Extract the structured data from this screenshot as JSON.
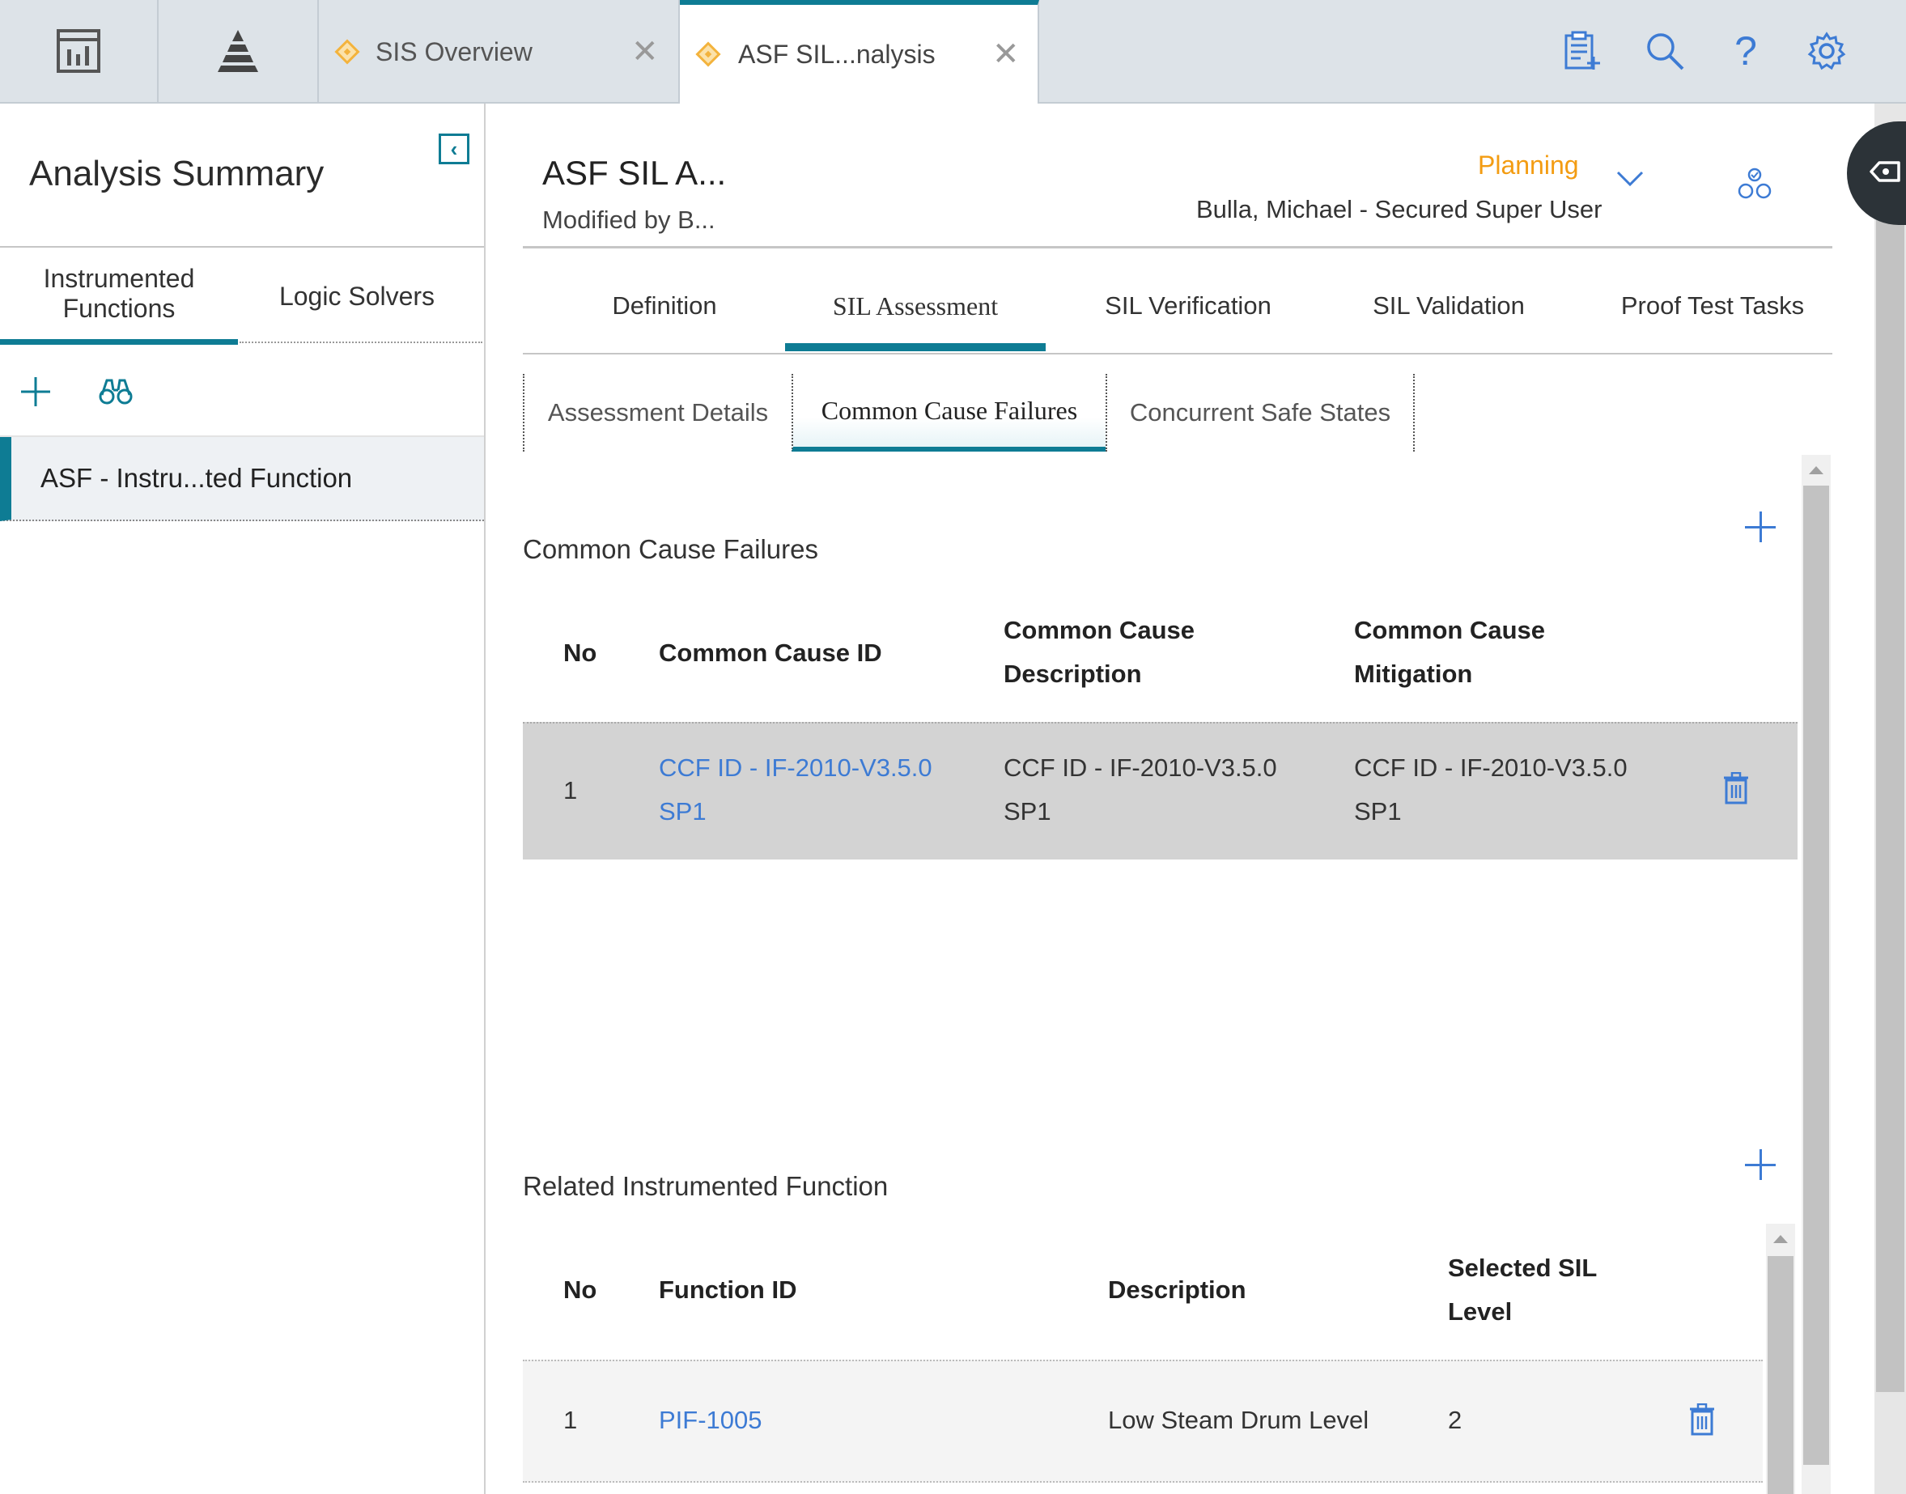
{
  "topbar": {
    "tabs": [
      {
        "label": "SIS Overview"
      },
      {
        "label": "ASF SIL...nalysis"
      }
    ],
    "close_glyph": "✕",
    "icons": [
      "dashboard-icon",
      "pyramid-icon",
      "clipboard-add-icon",
      "search-icon",
      "help-icon",
      "settings-icon"
    ],
    "help_glyph": "?"
  },
  "left_panel": {
    "title": "Analysis Summary",
    "collapse_glyph": "‹",
    "tabs": [
      {
        "label": "Instrumented Functions"
      },
      {
        "label": "Logic Solvers"
      }
    ],
    "toolbar_icons": [
      "add-icon",
      "binoculars-icon"
    ],
    "items": [
      {
        "label": "ASF - Instru...ted Function"
      }
    ]
  },
  "header": {
    "title": "ASF SIL A...",
    "modified_by": "Modified by B...",
    "state": "Planning",
    "state_user": "Bulla, Michael - Secured Super User"
  },
  "nav_tabs": [
    {
      "label": "Definition"
    },
    {
      "label": "SIL Assessment"
    },
    {
      "label": "SIL Verification"
    },
    {
      "label": "SIL Validation"
    },
    {
      "label": "Proof Test Tasks"
    }
  ],
  "sub_tabs": [
    {
      "label": "Assessment Details"
    },
    {
      "label": "Common Cause Failures"
    },
    {
      "label": "Concurrent Safe States"
    }
  ],
  "ccf_section": {
    "title": "Common Cause Failures",
    "columns": [
      "No",
      "Common Cause ID",
      "Common Cause\nDescription",
      "Common Cause\nMitigation"
    ],
    "rows": [
      {
        "no": "1",
        "id": "CCF ID - IF-2010-V3.5.0\nSP1",
        "description": "CCF ID - IF-2010-V3.5.0\nSP1",
        "mitigation": "CCF ID - IF-2010-V3.5.0\nSP1"
      }
    ]
  },
  "rif_section": {
    "title": "Related Instrumented Function",
    "columns": [
      "No",
      "Function ID",
      "Description",
      "Selected SIL\nLevel"
    ],
    "rows": [
      {
        "no": "1",
        "function_id": "PIF-1005",
        "description": "Low Steam Drum Level",
        "sil_level": "2"
      }
    ]
  },
  "colors": {
    "accent": "#0e7c94",
    "link": "#3d7bd4",
    "state": "#f39c12",
    "tabbar": "#dde3e8",
    "row_selected": "#d3d3d3"
  }
}
